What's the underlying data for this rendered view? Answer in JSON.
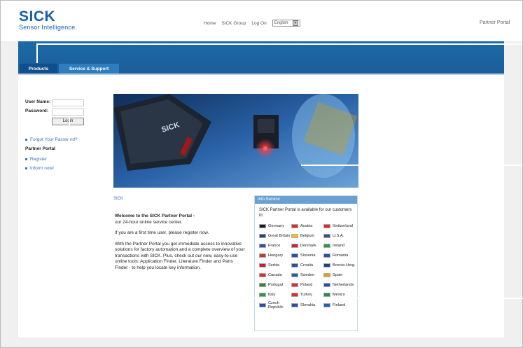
{
  "header": {
    "logo_word": "SICK",
    "logo_tagline": "Sensor Intelligence.",
    "links": [
      "Home",
      "SICK Group",
      "Log On"
    ],
    "language": "English",
    "partner_portal": "Partner Portal"
  },
  "nav": {
    "tabs": [
      "Products",
      "Service & Support"
    ]
  },
  "login": {
    "user_label": "User Name:",
    "password_label": "Password:",
    "button": "Login",
    "forgot": "Forgot Your Password?"
  },
  "sidebar": {
    "heading": "Partner Portal",
    "links": [
      "Register",
      "Inform now!"
    ]
  },
  "hero": {
    "camera_brand": "SICK"
  },
  "main": {
    "section_label": "SICK",
    "title": "Welcome to the SICK Partner Portal -",
    "subtitle": "our 24-hour online service center.",
    "first_time": "If you are a first time user, please register now.",
    "body": "With the Partner Portal you get immediate access to innovative solutions for factory automation and a complete overview of your transactions with SICK. Plus, check out our new, easy-to-use online tools: Application Finder, Literature Finder and Parts Finder - to help you locate key information."
  },
  "info_box": {
    "heading": "Info Service",
    "intro": "SICK Partner Portal is available for our customers in:",
    "countries": [
      {
        "name": "Germany",
        "flag": "#1a1a1a"
      },
      {
        "name": "Austria",
        "flag": "#e0282e"
      },
      {
        "name": "Switzerland",
        "flag": "#e0282e"
      },
      {
        "name": "Great Britain",
        "flag": "#1f3f8f"
      },
      {
        "name": "Belgium",
        "flag": "#f0c020"
      },
      {
        "name": "U.S.A.",
        "flag": "#3b4f8f"
      },
      {
        "name": "France",
        "flag": "#3050a8"
      },
      {
        "name": "Denmark",
        "flag": "#d0202e"
      },
      {
        "name": "Ireland",
        "flag": "#2a9a48"
      },
      {
        "name": "Hungary",
        "flag": "#c03a2e"
      },
      {
        "name": "Slovenia",
        "flag": "#2a4ea8"
      },
      {
        "name": "Romania",
        "flag": "#2a4ea8"
      },
      {
        "name": "Serbia",
        "flag": "#c02030"
      },
      {
        "name": "Croatia",
        "flag": "#2a4ea8"
      },
      {
        "name": "Bosnia-Herg.",
        "flag": "#1f3f8f"
      },
      {
        "name": "Canada",
        "flag": "#e0282e"
      },
      {
        "name": "Sweden",
        "flag": "#1f5fa8"
      },
      {
        "name": "Spain",
        "flag": "#e0a020"
      },
      {
        "name": "Portugal",
        "flag": "#2a8a38"
      },
      {
        "name": "Poland",
        "flag": "#e0283e"
      },
      {
        "name": "Netherlands",
        "flag": "#2a4ea8"
      },
      {
        "name": "Italy",
        "flag": "#2a9a48"
      },
      {
        "name": "Turkey",
        "flag": "#e0282e"
      },
      {
        "name": "Mexico",
        "flag": "#2a8a48"
      },
      {
        "name": "Czech Republic",
        "flag": "#2a4ea8"
      },
      {
        "name": "Slovakia",
        "flag": "#2a4ea8"
      },
      {
        "name": "Finland",
        "flag": "#2a5ab8"
      }
    ]
  }
}
